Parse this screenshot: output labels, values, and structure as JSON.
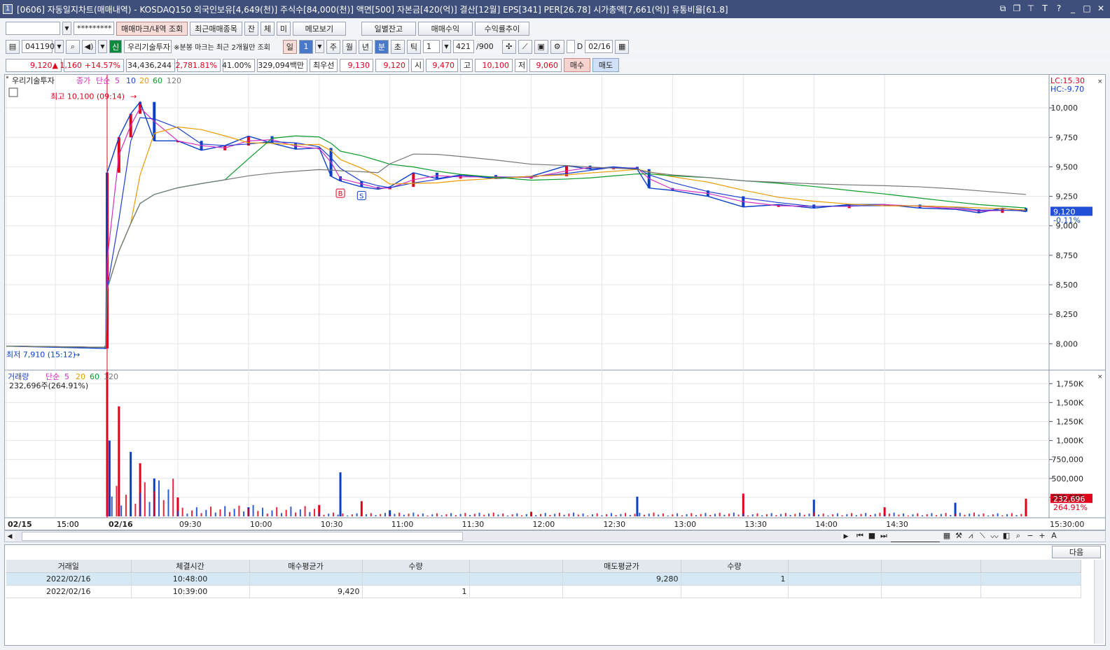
{
  "titlebar": {
    "icon": "1",
    "title": "[0606] 자동일지차트(매매내역) - KOSDAQ150 외국인보유[4,649(천)] 주식수[84,000(천)] 액면[500] 자본금[420(억)] 결산[12월] EPS[341] PER[26.78] 시가총액[7,661(억)] 유통비율[61.8]"
  },
  "toolbar1": {
    "account_placeholder": "",
    "password_mask": "*********",
    "btn_trade_mark": "매매마크/내역 조회",
    "btn_recent": "최근매매종목",
    "btn_jan": "잔",
    "btn_che": "체",
    "btn_mi": "미",
    "btn_memo": "메모보기",
    "btn_daily_balance": "일별잔고",
    "btn_trade_profit": "매매수익",
    "btn_return_trend": "수익률추이"
  },
  "toolbar2": {
    "code": "041190",
    "credit_badge": "신",
    "stock_name": "우리기술투자",
    "notice": "※분봉 마크는 최근 2개월만 조회",
    "period_day": "일",
    "period_day_num": "1",
    "period_week": "주",
    "period_month": "월",
    "period_year": "년",
    "period_min": "분",
    "period_sec": "초",
    "period_tick": "틱",
    "interval": "1",
    "count": "421",
    "count_max": "/900",
    "date_label": "D",
    "date": "02/16"
  },
  "quote": {
    "price": "9,120",
    "change_sign": "▲",
    "change": "1,160",
    "change_pct": "+14.57%",
    "volume": "34,436,244",
    "volume_ratio": "2,781.81%",
    "pct2": "41.00%",
    "amount": "329,094백만",
    "best_label": "최우선",
    "best_ask": "9,130",
    "best_bid": "9,120",
    "open_label": "시",
    "open": "9,470",
    "high_label": "고",
    "high": "10,100",
    "low_label": "저",
    "low": "9,060",
    "btn_buy": "매수",
    "btn_sell": "매도"
  },
  "chart_data": [
    {
      "type": "line",
      "title": "",
      "legend": {
        "stock": "우리기술투자",
        "price_label": "종가",
        "ma_type": "단순",
        "ma5": "5",
        "ma10": "10",
        "ma20": "20",
        "ma60": "60",
        "ma120": "120"
      },
      "ylim": [
        7800,
        10250
      ],
      "y_ticks": [
        "10,000",
        "9,750",
        "9,500",
        "9,250",
        "9,000",
        "8,750",
        "8,500",
        "8,250",
        "8,000"
      ],
      "x_ticks": [
        "02/15",
        "15:00",
        "02/16",
        "09:30",
        "10:00",
        "10:30",
        "11:00",
        "11:30",
        "12:00",
        "12:30",
        "13:00",
        "13:30",
        "14:00",
        "14:30",
        "15:00",
        "15:30:00"
      ],
      "high_annotation": "최고 10,100 (09:14)",
      "low_annotation": "최저 7,910 (15:12)",
      "lc_label": "LC:15.30",
      "hc_label": "HC:-9.70",
      "last_price": "9,120",
      "last_change": "-0.11%",
      "buy_marker": "B",
      "sell_marker": "S",
      "series": [
        {
          "name": "종가",
          "x": [
            "14:40",
            "15:30",
            "09:00",
            "09:05",
            "09:10",
            "09:14",
            "09:20",
            "09:30",
            "09:40",
            "09:50",
            "10:00",
            "10:10",
            "10:20",
            "10:30",
            "10:35",
            "10:39",
            "10:48",
            "10:55",
            "11:00",
            "11:10",
            "11:20",
            "11:30",
            "11:45",
            "12:00",
            "12:15",
            "12:25",
            "12:35",
            "12:45",
            "12:50",
            "13:00",
            "13:15",
            "13:30",
            "13:45",
            "14:00",
            "14:15",
            "14:30",
            "14:45",
            "15:00",
            "15:10",
            "15:20",
            "15:30"
          ],
          "values": [
            7980,
            7960,
            9450,
            9750,
            9950,
            10050,
            9720,
            9720,
            9640,
            9680,
            9760,
            9700,
            9650,
            9660,
            9420,
            9380,
            9330,
            9310,
            9330,
            9450,
            9400,
            9430,
            9400,
            9420,
            9510,
            9480,
            9500,
            9480,
            9320,
            9300,
            9250,
            9160,
            9180,
            9150,
            9180,
            9180,
            9150,
            9140,
            9110,
            9150,
            9120
          ]
        }
      ]
    },
    {
      "type": "bar",
      "title": "",
      "legend": {
        "name": "거래량",
        "ma_type": "단순",
        "ma5": "5",
        "ma20": "20",
        "ma60": "60",
        "ma120": "120"
      },
      "current_label": "232,696주(264.91%)",
      "ylim": [
        0,
        1900000
      ],
      "y_ticks": [
        "1,750K",
        "1,500K",
        "1,250K",
        "1,000K",
        "750,000",
        "500,000",
        "250,000"
      ],
      "last_volume": "232,696",
      "last_volume_pct": "264.91%",
      "series": [
        {
          "name": "거래량",
          "x": [
            "09:00",
            "09:01",
            "09:05",
            "09:10",
            "09:14",
            "09:20",
            "09:30",
            "10:00",
            "10:30",
            "10:39",
            "10:48",
            "11:00",
            "12:00",
            "12:45",
            "13:30",
            "14:00",
            "14:30",
            "15:00",
            "15:30"
          ],
          "values": [
            1900000,
            1000000,
            1450000,
            850000,
            700000,
            500000,
            250000,
            120000,
            150000,
            580000,
            200000,
            80000,
            60000,
            260000,
            300000,
            220000,
            120000,
            180000,
            232696
          ]
        }
      ]
    }
  ],
  "scrollbar": {
    "ctrl_icons": [
      "play-icon",
      "rewind-icon",
      "stop-icon",
      "forward-icon"
    ],
    "zoom_out": "−",
    "zoom_in": "+",
    "text_icon": "A"
  },
  "trades": {
    "next_button": "다음",
    "columns": [
      "거래일",
      "체결시간",
      "매수평균가",
      "수량",
      "",
      "매도평균가",
      "수량",
      "",
      "",
      ""
    ],
    "rows": [
      {
        "date": "2022/02/16",
        "time": "10:48:00",
        "buy_price": "",
        "buy_qty": "",
        "sell_price": "9,280",
        "sell_qty": "1"
      },
      {
        "date": "2022/02/16",
        "time": "10:39:00",
        "buy_price": "9,420",
        "buy_qty": "1",
        "sell_price": "",
        "sell_qty": ""
      }
    ]
  },
  "colors": {
    "titlebar": "#3e4f7c",
    "up": "#e0001b",
    "down": "#0b3fc8",
    "ma5": "#d42fc0",
    "ma10": "#1f3fd0",
    "ma20": "#e89b00",
    "ma60": "#0a9a2a",
    "ma120": "#777777"
  }
}
